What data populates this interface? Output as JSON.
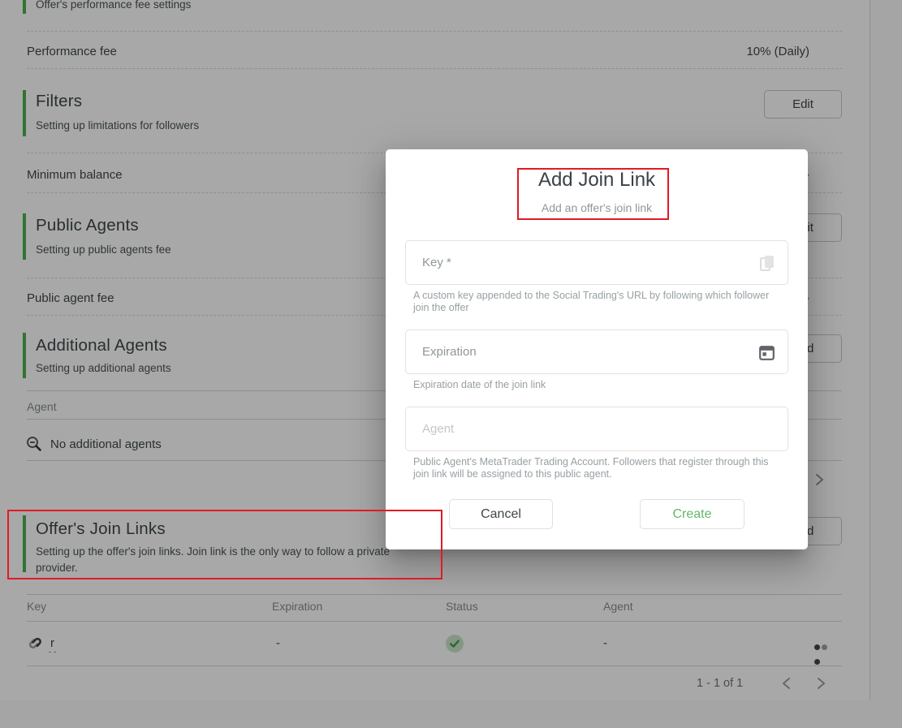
{
  "page": {
    "top_section_subtitle": "Offer's performance fee settings",
    "rows": {
      "performance_fee": {
        "label": "Performance fee",
        "value": "10% (Daily)"
      },
      "minimum_balance": {
        "label": "Minimum balance",
        "value": "-"
      },
      "public_agent_fee": {
        "label": "Public agent fee",
        "value": "-"
      }
    },
    "sections": {
      "filters": {
        "title": "Filters",
        "subtitle": "Setting up limitations for followers",
        "action": "Edit"
      },
      "public_agents": {
        "title": "Public Agents",
        "subtitle": "Setting up public agents fee",
        "action": "Edit"
      },
      "additional_agents": {
        "title": "Additional Agents",
        "subtitle": "Setting up additional agents",
        "action": "Add"
      },
      "join_links": {
        "title": "Offer's Join Links",
        "subtitle": "Setting up the offer's join links. Join link is the only way to follow a private provider.",
        "action": "Add"
      }
    },
    "agents_table": {
      "header": "Agent",
      "empty_text": "No additional agents"
    },
    "join_links_table": {
      "headers": {
        "key": "Key",
        "expiration": "Expiration",
        "status": "Status",
        "agent": "Agent"
      },
      "row": {
        "key": "r",
        "expiration": "-",
        "agent": "-",
        "status_icon": "check-circle"
      },
      "pagination": {
        "range": "1 - 1 of 1"
      }
    }
  },
  "modal": {
    "title": "Add Join Link",
    "subtitle": "Add an offer's join link",
    "fields": {
      "key": {
        "label": "Key *",
        "helper": "A custom key appended to the Social Trading's URL by following which follower join the offer",
        "icon": "copy-icon"
      },
      "expiration": {
        "label": "Expiration",
        "helper": "Expiration date of the join link",
        "icon": "calendar-icon"
      },
      "agent": {
        "label": "Agent",
        "helper": "Public Agent's MetaTrader Trading Account. Followers that register through this join link will be assigned to this public agent."
      }
    },
    "buttons": {
      "cancel": "Cancel",
      "create": "Create"
    }
  },
  "colors": {
    "accent_green": "#4caf50",
    "create_green": "#63b867",
    "status_circle_green": "#c8e6c9",
    "status_check_green": "#43a047",
    "annotation_red": "#e01b24"
  }
}
